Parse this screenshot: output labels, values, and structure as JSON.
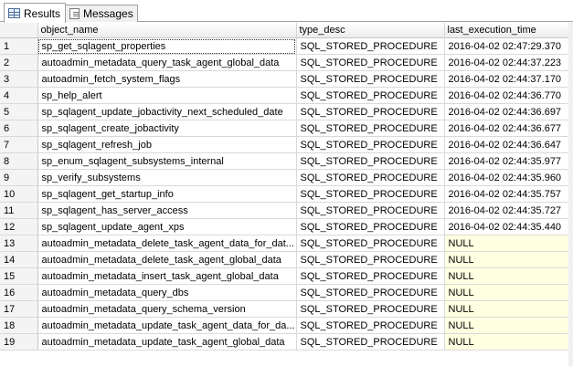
{
  "tabs": [
    {
      "label": "Results",
      "icon": "results-grid-icon"
    },
    {
      "label": "Messages",
      "icon": "messages-icon"
    }
  ],
  "columns": [
    "object_name",
    "type_desc",
    "last_execution_time"
  ],
  "rows": [
    {
      "n": "1",
      "name": "sp_get_sqlagent_properties",
      "type": "SQL_STORED_PROCEDURE",
      "time": "2016-04-02 02:47:29.370"
    },
    {
      "n": "2",
      "name": "autoadmin_metadata_query_task_agent_global_data",
      "type": "SQL_STORED_PROCEDURE",
      "time": "2016-04-02 02:44:37.223"
    },
    {
      "n": "3",
      "name": "autoadmin_fetch_system_flags",
      "type": "SQL_STORED_PROCEDURE",
      "time": "2016-04-02 02:44:37.170"
    },
    {
      "n": "4",
      "name": "sp_help_alert",
      "type": "SQL_STORED_PROCEDURE",
      "time": "2016-04-02 02:44:36.770"
    },
    {
      "n": "5",
      "name": "sp_sqlagent_update_jobactivity_next_scheduled_date",
      "type": "SQL_STORED_PROCEDURE",
      "time": "2016-04-02 02:44:36.697"
    },
    {
      "n": "6",
      "name": "sp_sqlagent_create_jobactivity",
      "type": "SQL_STORED_PROCEDURE",
      "time": "2016-04-02 02:44:36.677"
    },
    {
      "n": "7",
      "name": "sp_sqlagent_refresh_job",
      "type": "SQL_STORED_PROCEDURE",
      "time": "2016-04-02 02:44:36.647"
    },
    {
      "n": "8",
      "name": "sp_enum_sqlagent_subsystems_internal",
      "type": "SQL_STORED_PROCEDURE",
      "time": "2016-04-02 02:44:35.977"
    },
    {
      "n": "9",
      "name": "sp_verify_subsystems",
      "type": "SQL_STORED_PROCEDURE",
      "time": "2016-04-02 02:44:35.960"
    },
    {
      "n": "10",
      "name": "sp_sqlagent_get_startup_info",
      "type": "SQL_STORED_PROCEDURE",
      "time": "2016-04-02 02:44:35.757"
    },
    {
      "n": "11",
      "name": "sp_sqlagent_has_server_access",
      "type": "SQL_STORED_PROCEDURE",
      "time": "2016-04-02 02:44:35.727"
    },
    {
      "n": "12",
      "name": "sp_sqlagent_update_agent_xps",
      "type": "SQL_STORED_PROCEDURE",
      "time": "2016-04-02 02:44:35.440"
    },
    {
      "n": "13",
      "name": "autoadmin_metadata_delete_task_agent_data_for_dat...",
      "type": "SQL_STORED_PROCEDURE",
      "time": "NULL"
    },
    {
      "n": "14",
      "name": "autoadmin_metadata_delete_task_agent_global_data",
      "type": "SQL_STORED_PROCEDURE",
      "time": "NULL"
    },
    {
      "n": "15",
      "name": "autoadmin_metadata_insert_task_agent_global_data",
      "type": "SQL_STORED_PROCEDURE",
      "time": "NULL"
    },
    {
      "n": "16",
      "name": "autoadmin_metadata_query_dbs",
      "type": "SQL_STORED_PROCEDURE",
      "time": "NULL"
    },
    {
      "n": "17",
      "name": "autoadmin_metadata_query_schema_version",
      "type": "SQL_STORED_PROCEDURE",
      "time": "NULL"
    },
    {
      "n": "18",
      "name": "autoadmin_metadata_update_task_agent_data_for_da...",
      "type": "SQL_STORED_PROCEDURE",
      "time": "NULL"
    },
    {
      "n": "19",
      "name": "autoadmin_metadata_update_task_agent_global_data",
      "type": "SQL_STORED_PROCEDURE",
      "time": "NULL"
    }
  ],
  "colors": {
    "null_cell": "#ffffe1",
    "header": "#ececec",
    "row_number": "#f4f4f4"
  }
}
